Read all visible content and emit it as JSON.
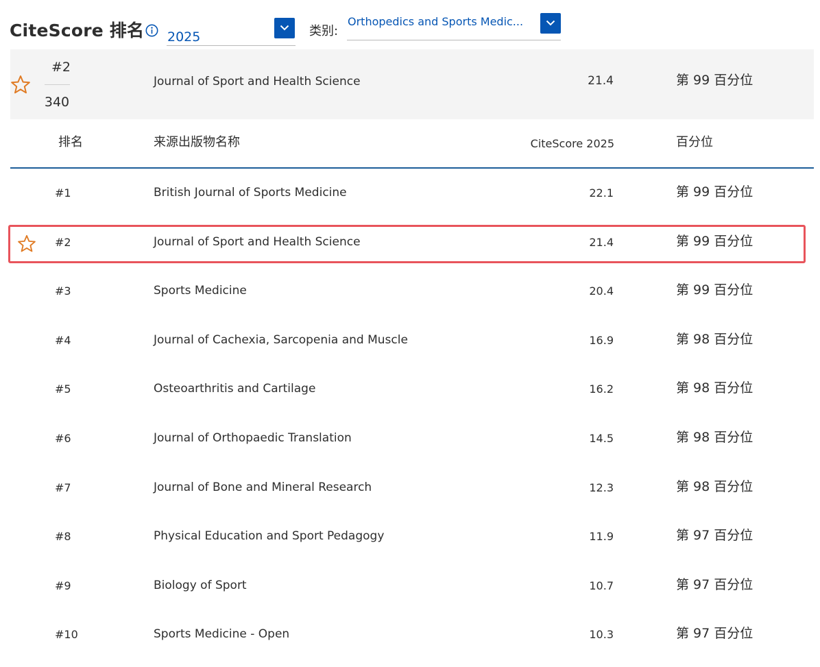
{
  "header": {
    "title": "CiteScore 排名",
    "year": "2025",
    "category_label": "类别:",
    "category": "Orthopedics and Sports Medic..."
  },
  "summary": {
    "rank": "#2",
    "total": "340",
    "title": "Journal of Sport and Health Science",
    "score": "21.4",
    "percentile": "第 99 百分位"
  },
  "table": {
    "columns": [
      "排名",
      "来源出版物名称",
      "CiteScore 2025",
      "百分位"
    ],
    "rows": [
      {
        "rank": "#1",
        "title": "British Journal of Sports Medicine",
        "score": "22.1",
        "percentile": "第 99 百分位"
      },
      {
        "rank": "#2",
        "title": "Journal of Sport and Health Science",
        "score": "21.4",
        "percentile": "第 99 百分位"
      },
      {
        "rank": "#3",
        "title": "Sports Medicine",
        "score": "20.4",
        "percentile": "第 99 百分位"
      },
      {
        "rank": "#4",
        "title": "Journal of Cachexia, Sarcopenia and Muscle",
        "score": "16.9",
        "percentile": "第 98 百分位"
      },
      {
        "rank": "#5",
        "title": "Osteoarthritis and Cartilage",
        "score": "16.2",
        "percentile": "第 98 百分位"
      },
      {
        "rank": "#6",
        "title": "Journal of Orthopaedic Translation",
        "score": "14.5",
        "percentile": "第 98 百分位"
      },
      {
        "rank": "#7",
        "title": "Journal of Bone and Mineral Research",
        "score": "12.3",
        "percentile": "第 98 百分位"
      },
      {
        "rank": "#8",
        "title": "Physical Education and Sport Pedagogy",
        "score": "11.9",
        "percentile": "第 97 百分位"
      },
      {
        "rank": "#9",
        "title": "Biology of Sport",
        "score": "10.7",
        "percentile": "第 97 百分位"
      },
      {
        "rank": "#10",
        "title": "Sports Medicine - Open",
        "score": "10.3",
        "percentile": "第 97 百分位"
      }
    ]
  },
  "icons": {
    "star": "star-outline-icon",
    "info": "info-circle-icon",
    "dropdown": "chevron-down-icon"
  },
  "colors": {
    "accent": "#0656b4",
    "star": "#e07b24",
    "highlight_border": "#e8545b",
    "header_rule": "#1c5d99",
    "summary_bg": "#f4f4f4"
  }
}
